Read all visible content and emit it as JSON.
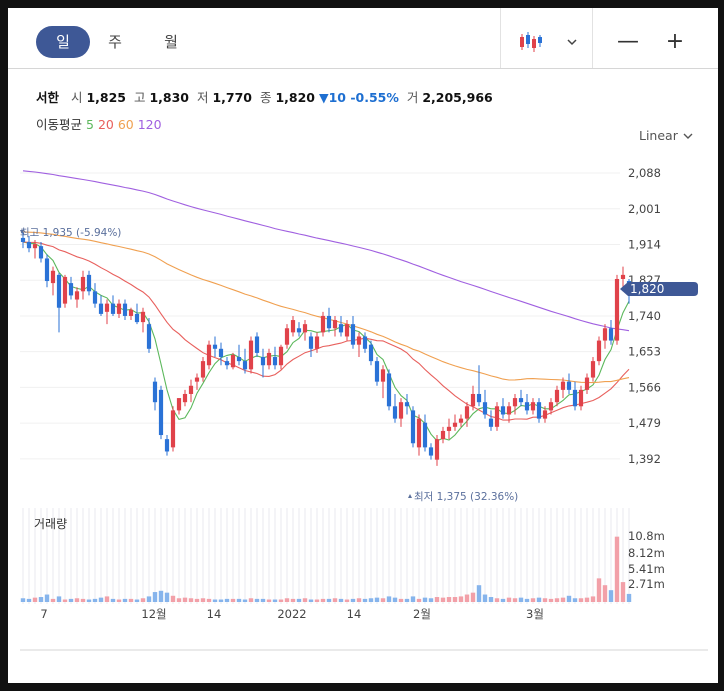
{
  "tabs": [
    {
      "label": "일",
      "active": true
    },
    {
      "label": "주",
      "active": false
    },
    {
      "label": "월",
      "active": false
    }
  ],
  "toolbar": {
    "chart_type_icon": "candlestick-icon",
    "dropdown_icon": "chevron-down-icon",
    "zoom_out": "—",
    "zoom_in": "+"
  },
  "stock": {
    "name": "서한",
    "open_label": "시",
    "open": "1,825",
    "high_label": "고",
    "high": "1,830",
    "low_label": "저",
    "low": "1,770",
    "close_label": "종",
    "close": "1,820",
    "change": "▼10 -0.55%",
    "volume_label": "거",
    "volume": "2,205,966"
  },
  "moving_average": {
    "label": "이동평균",
    "periods": [
      "5",
      "20",
      "60",
      "120"
    ],
    "colors": [
      "#5cb85c",
      "#e8605d",
      "#f0a050",
      "#a060e0"
    ]
  },
  "scale_button": "Linear",
  "annotations": {
    "high": "최고 1,935 (-5.94%)",
    "low": "최저 1,375 (32.36%)"
  },
  "current_price_tag": "1,820",
  "volume_panel_label": "거래량",
  "colors": {
    "up": "#e0424a",
    "down": "#2a72d6",
    "accent": "#3e5896"
  },
  "chart_data": {
    "type": "candlestick",
    "price_axis": {
      "ticks": [
        "2,088",
        "2,001",
        "1,914",
        "1,827",
        "1,740",
        "1,653",
        "1,566",
        "1,479",
        "1,392"
      ],
      "range": [
        1360,
        2110
      ]
    },
    "volume_axis": {
      "ticks": [
        "10.8m",
        "8.12m",
        "5.41m",
        "2.71m"
      ],
      "range": [
        0,
        13.5
      ]
    },
    "x_ticks": [
      "7",
      "12월",
      "14",
      "2022",
      "14",
      "2월",
      "3월"
    ],
    "candles": [
      [
        1930,
        1945,
        1905,
        1920
      ],
      [
        1920,
        1935,
        1895,
        1905
      ],
      [
        1905,
        1925,
        1880,
        1915
      ],
      [
        1910,
        1920,
        1870,
        1880
      ],
      [
        1880,
        1890,
        1810,
        1825
      ],
      [
        1820,
        1860,
        1790,
        1850
      ],
      [
        1840,
        1845,
        1700,
        1760
      ],
      [
        1770,
        1840,
        1760,
        1835
      ],
      [
        1820,
        1835,
        1780,
        1790
      ],
      [
        1780,
        1810,
        1760,
        1800
      ],
      [
        1800,
        1850,
        1780,
        1835
      ],
      [
        1840,
        1850,
        1790,
        1800
      ],
      [
        1800,
        1820,
        1760,
        1770
      ],
      [
        1770,
        1790,
        1740,
        1745
      ],
      [
        1750,
        1780,
        1720,
        1770
      ],
      [
        1770,
        1790,
        1740,
        1745
      ],
      [
        1745,
        1780,
        1735,
        1770
      ],
      [
        1770,
        1780,
        1730,
        1740
      ],
      [
        1740,
        1760,
        1730,
        1755
      ],
      [
        1745,
        1770,
        1720,
        1725
      ],
      [
        1725,
        1760,
        1700,
        1750
      ],
      [
        1720,
        1735,
        1650,
        1660
      ],
      [
        1580,
        1590,
        1510,
        1530
      ],
      [
        1560,
        1570,
        1440,
        1450
      ],
      [
        1440,
        1450,
        1400,
        1410
      ],
      [
        1420,
        1520,
        1410,
        1510
      ],
      [
        1510,
        1540,
        1500,
        1540
      ],
      [
        1530,
        1560,
        1520,
        1550
      ],
      [
        1550,
        1585,
        1530,
        1570
      ],
      [
        1580,
        1600,
        1560,
        1590
      ],
      [
        1590,
        1640,
        1580,
        1630
      ],
      [
        1620,
        1680,
        1610,
        1670
      ],
      [
        1670,
        1690,
        1640,
        1660
      ],
      [
        1660,
        1675,
        1620,
        1640
      ],
      [
        1630,
        1640,
        1610,
        1620
      ],
      [
        1615,
        1650,
        1610,
        1645
      ],
      [
        1640,
        1670,
        1620,
        1630
      ],
      [
        1630,
        1660,
        1600,
        1610
      ],
      [
        1610,
        1690,
        1600,
        1680
      ],
      [
        1690,
        1700,
        1640,
        1650
      ],
      [
        1640,
        1660,
        1590,
        1620
      ],
      [
        1620,
        1660,
        1610,
        1650
      ],
      [
        1640,
        1665,
        1610,
        1620
      ],
      [
        1620,
        1670,
        1610,
        1665
      ],
      [
        1670,
        1720,
        1660,
        1710
      ],
      [
        1700,
        1740,
        1690,
        1730
      ],
      [
        1710,
        1725,
        1690,
        1700
      ],
      [
        1700,
        1730,
        1680,
        1720
      ],
      [
        1690,
        1700,
        1640,
        1660
      ],
      [
        1660,
        1700,
        1650,
        1690
      ],
      [
        1700,
        1750,
        1690,
        1740
      ],
      [
        1740,
        1760,
        1700,
        1710
      ],
      [
        1710,
        1740,
        1690,
        1730
      ],
      [
        1720,
        1740,
        1690,
        1700
      ],
      [
        1690,
        1730,
        1680,
        1720
      ],
      [
        1720,
        1740,
        1660,
        1670
      ],
      [
        1670,
        1700,
        1640,
        1690
      ],
      [
        1690,
        1700,
        1650,
        1660
      ],
      [
        1670,
        1680,
        1620,
        1630
      ],
      [
        1630,
        1640,
        1570,
        1580
      ],
      [
        1580,
        1620,
        1540,
        1610
      ],
      [
        1600,
        1610,
        1510,
        1520
      ],
      [
        1520,
        1550,
        1480,
        1490
      ],
      [
        1490,
        1540,
        1470,
        1530
      ],
      [
        1530,
        1550,
        1500,
        1520
      ],
      [
        1510,
        1520,
        1420,
        1430
      ],
      [
        1420,
        1500,
        1400,
        1490
      ],
      [
        1480,
        1500,
        1410,
        1420
      ],
      [
        1420,
        1430,
        1390,
        1400
      ],
      [
        1390,
        1450,
        1375,
        1440
      ],
      [
        1440,
        1470,
        1430,
        1460
      ],
      [
        1460,
        1490,
        1440,
        1470
      ],
      [
        1470,
        1500,
        1460,
        1480
      ],
      [
        1480,
        1500,
        1470,
        1490
      ],
      [
        1490,
        1530,
        1470,
        1520
      ],
      [
        1520,
        1570,
        1510,
        1550
      ],
      [
        1550,
        1620,
        1520,
        1530
      ],
      [
        1530,
        1560,
        1490,
        1500
      ],
      [
        1490,
        1510,
        1460,
        1470
      ],
      [
        1470,
        1530,
        1460,
        1520
      ],
      [
        1520,
        1540,
        1490,
        1500
      ],
      [
        1500,
        1530,
        1480,
        1520
      ],
      [
        1520,
        1550,
        1500,
        1540
      ],
      [
        1540,
        1560,
        1520,
        1530
      ],
      [
        1530,
        1550,
        1500,
        1510
      ],
      [
        1510,
        1540,
        1500,
        1530
      ],
      [
        1530,
        1540,
        1480,
        1490
      ],
      [
        1490,
        1520,
        1480,
        1510
      ],
      [
        1510,
        1540,
        1500,
        1530
      ],
      [
        1530,
        1570,
        1520,
        1560
      ],
      [
        1560,
        1590,
        1540,
        1580
      ],
      [
        1580,
        1600,
        1550,
        1560
      ],
      [
        1560,
        1580,
        1510,
        1520
      ],
      [
        1520,
        1570,
        1510,
        1560
      ],
      [
        1560,
        1600,
        1550,
        1590
      ],
      [
        1590,
        1640,
        1580,
        1630
      ],
      [
        1630,
        1690,
        1620,
        1680
      ],
      [
        1680,
        1720,
        1660,
        1710
      ],
      [
        1710,
        1730,
        1670,
        1680
      ],
      [
        1680,
        1840,
        1670,
        1830
      ],
      [
        1830,
        1860,
        1800,
        1840
      ],
      [
        1825,
        1830,
        1770,
        1820
      ]
    ],
    "volumes": [
      0.6,
      0.5,
      0.7,
      0.8,
      1.2,
      0.5,
      0.9,
      0.4,
      0.5,
      0.6,
      0.5,
      0.4,
      0.5,
      0.7,
      0.9,
      0.5,
      0.4,
      0.5,
      0.5,
      0.4,
      0.6,
      0.9,
      1.6,
      1.8,
      1.5,
      1.0,
      0.6,
      0.7,
      0.6,
      0.5,
      0.6,
      0.5,
      0.4,
      0.4,
      0.5,
      0.5,
      0.5,
      0.4,
      0.6,
      0.5,
      0.5,
      0.4,
      0.4,
      0.4,
      0.6,
      0.5,
      0.5,
      0.6,
      0.4,
      0.4,
      0.5,
      0.5,
      0.6,
      0.5,
      0.4,
      0.5,
      0.6,
      0.5,
      0.6,
      0.7,
      0.6,
      0.9,
      0.7,
      0.5,
      0.5,
      0.9,
      0.5,
      0.7,
      0.6,
      0.8,
      0.7,
      0.8,
      0.8,
      0.9,
      1.2,
      1.5,
      2.7,
      1.2,
      0.8,
      0.6,
      0.5,
      0.7,
      0.6,
      0.7,
      0.5,
      0.6,
      0.7,
      0.6,
      0.5,
      0.6,
      0.7,
      1.0,
      0.6,
      0.6,
      0.7,
      0.9,
      3.8,
      2.7,
      1.9,
      10.5,
      3.2,
      1.3
    ]
  }
}
